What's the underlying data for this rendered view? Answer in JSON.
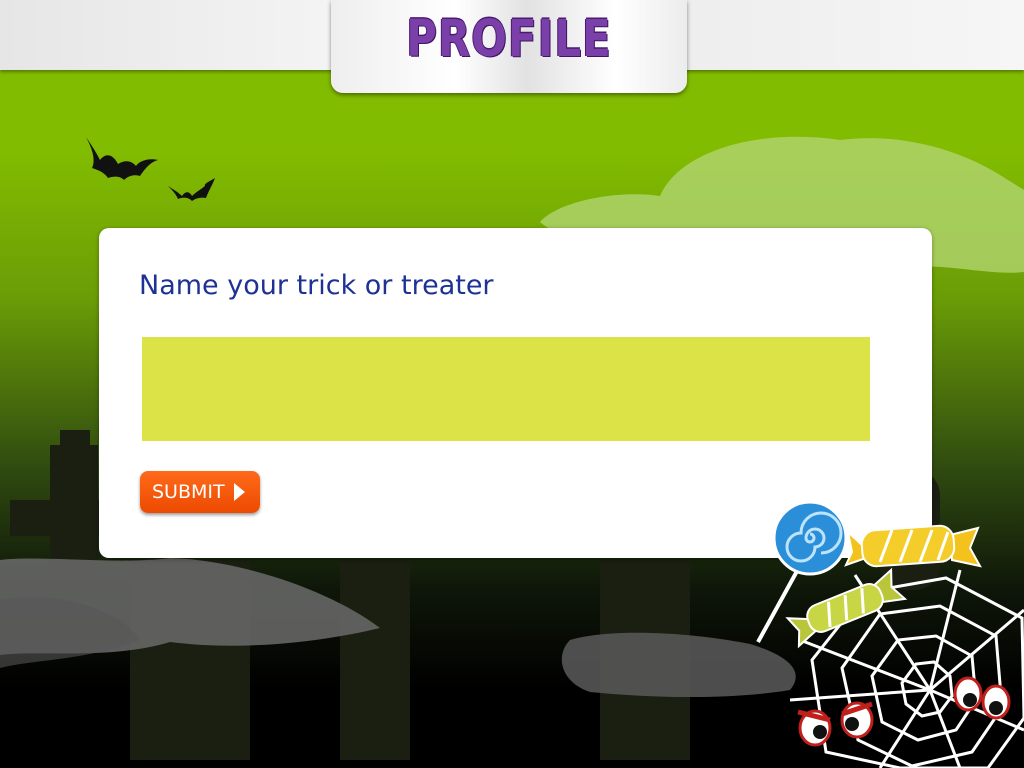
{
  "header": {
    "title": "PROFILE"
  },
  "form": {
    "heading": "Name your trick or treater",
    "name_value": "",
    "submit_label": "SUBMIT"
  },
  "colors": {
    "sky_green": "#82bc00",
    "input_yellow": "#dce346",
    "heading_blue": "#1e3296",
    "submit_orange": "#f45a0a",
    "title_purple": "#7a3fa8"
  },
  "decorations": {
    "icons": [
      "bat-icon",
      "bat-icon",
      "lollipop-icon",
      "wrapped-candy-icon",
      "wrapped-candy-icon",
      "spider-web-icon",
      "glowing-eyes-icon",
      "glowing-eyes-icon"
    ]
  }
}
